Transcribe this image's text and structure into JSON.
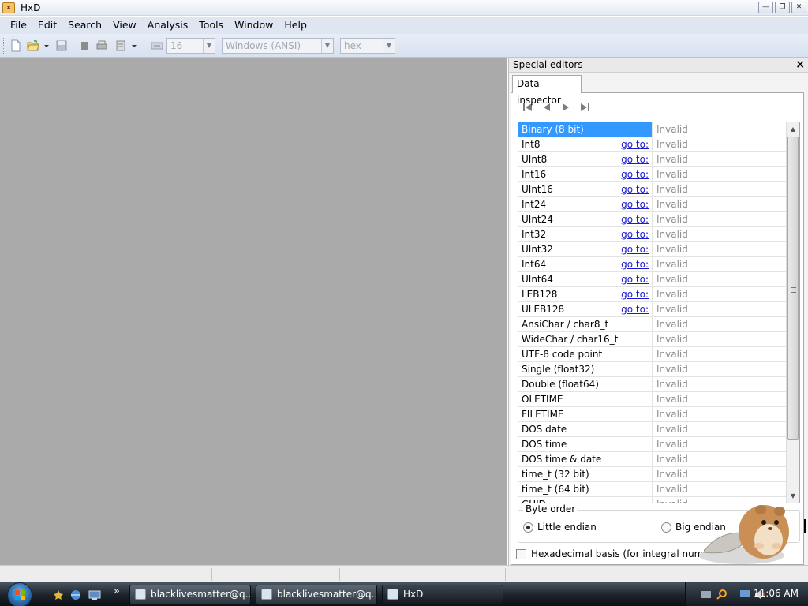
{
  "window": {
    "title": "HxD"
  },
  "menu": [
    "File",
    "Edit",
    "Search",
    "View",
    "Analysis",
    "Tools",
    "Window",
    "Help"
  ],
  "toolbar": {
    "bytes_per_row": "16",
    "charset": "Windows (ANSI)",
    "offset_base": "hex"
  },
  "panel": {
    "title": "Special editors",
    "close_glyph": "×",
    "tab": "Data inspector",
    "rows": [
      {
        "name": "Binary (8 bit)",
        "goto": "",
        "value": "Invalid",
        "selected": true
      },
      {
        "name": "Int8",
        "goto": "go to:",
        "value": "Invalid"
      },
      {
        "name": "UInt8",
        "goto": "go to:",
        "value": "Invalid"
      },
      {
        "name": "Int16",
        "goto": "go to:",
        "value": "Invalid"
      },
      {
        "name": "UInt16",
        "goto": "go to:",
        "value": "Invalid"
      },
      {
        "name": "Int24",
        "goto": "go to:",
        "value": "Invalid"
      },
      {
        "name": "UInt24",
        "goto": "go to:",
        "value": "Invalid"
      },
      {
        "name": "Int32",
        "goto": "go to:",
        "value": "Invalid"
      },
      {
        "name": "UInt32",
        "goto": "go to:",
        "value": "Invalid"
      },
      {
        "name": "Int64",
        "goto": "go to:",
        "value": "Invalid"
      },
      {
        "name": "UInt64",
        "goto": "go to:",
        "value": "Invalid"
      },
      {
        "name": "LEB128",
        "goto": "go to:",
        "value": "Invalid"
      },
      {
        "name": "ULEB128",
        "goto": "go to:",
        "value": "Invalid"
      },
      {
        "name": "AnsiChar / char8_t",
        "goto": "",
        "value": "Invalid"
      },
      {
        "name": "WideChar / char16_t",
        "goto": "",
        "value": "Invalid"
      },
      {
        "name": "UTF-8 code point",
        "goto": "",
        "value": "Invalid"
      },
      {
        "name": "Single (float32)",
        "goto": "",
        "value": "Invalid"
      },
      {
        "name": "Double (float64)",
        "goto": "",
        "value": "Invalid"
      },
      {
        "name": "OLETIME",
        "goto": "",
        "value": "Invalid"
      },
      {
        "name": "FILETIME",
        "goto": "",
        "value": "Invalid"
      },
      {
        "name": "DOS date",
        "goto": "",
        "value": "Invalid"
      },
      {
        "name": "DOS time",
        "goto": "",
        "value": "Invalid"
      },
      {
        "name": "DOS time & date",
        "goto": "",
        "value": "Invalid"
      },
      {
        "name": "time_t (32 bit)",
        "goto": "",
        "value": "Invalid"
      },
      {
        "name": "time_t (64 bit)",
        "goto": "",
        "value": "Invalid"
      },
      {
        "name": "GUID",
        "goto": "",
        "value": "Invalid"
      }
    ],
    "byte_order": {
      "legend": "Byte order",
      "little": "Little endian",
      "big": "Big endian",
      "selected": "little"
    },
    "hex_basis_label": "Hexadecimal basis (for integral numbers)",
    "hex_basis_checked": false
  },
  "taskbar": {
    "buttons": [
      {
        "label": "blacklivesmatter@q...",
        "active": false
      },
      {
        "label": "blacklivesmatter@q...",
        "active": false
      },
      {
        "label": "HxD",
        "active": true
      }
    ],
    "overflow_glyph": "»",
    "clock": "11:06 AM"
  },
  "colors": {
    "selection": "#3399ff",
    "link": "#1a1ad4",
    "invalid_text": "#8f8f8f",
    "workspace": "#aaaaaa"
  }
}
